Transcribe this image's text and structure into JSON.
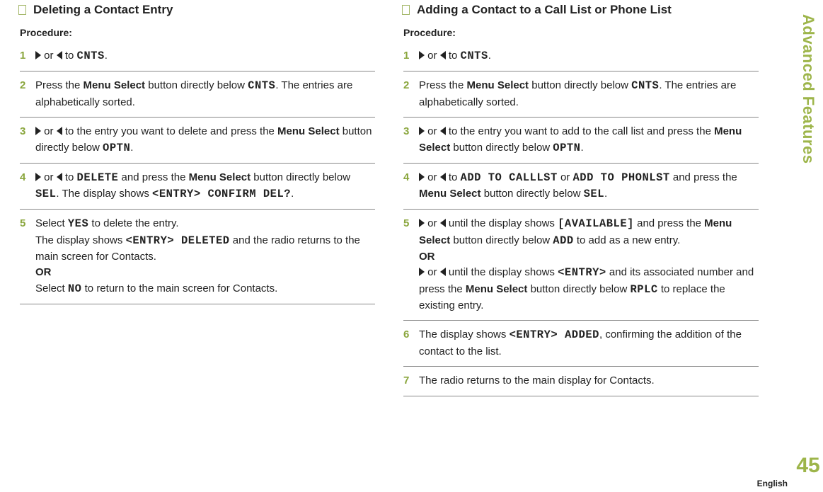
{
  "sidebar": {
    "label": "Advanced Features",
    "page": "45"
  },
  "footer": {
    "lang": "English"
  },
  "left": {
    "title": "Deleting a Contact Entry",
    "procedure": "Procedure:",
    "s1a": " or ",
    "s1b": " to ",
    "s1c": "CNTS",
    "s1d": ".",
    "s2a": "Press the ",
    "s2b": "Menu Select",
    "s2c": " button directly below ",
    "s2d": "CNTS",
    "s2e": ". The entries are alphabetically sorted.",
    "s3a": " or ",
    "s3b": " to the entry you want to delete and press the ",
    "s3c": "Menu Select",
    "s3d": " button directly below ",
    "s3e": "OPTN",
    "s3f": ".",
    "s4a": " or ",
    "s4b": " to ",
    "s4c": "DELETE",
    "s4d": " and press the ",
    "s4e": "Menu Select",
    "s4f": " button directly below ",
    "s4g": "SEL",
    "s4h": ". The display shows ",
    "s4i": "<ENTRY> CONFIRM DEL?",
    "s4j": ".",
    "s5a": "Select ",
    "s5b": "YES",
    "s5c": " to delete the entry.",
    "s5d": "The display shows ",
    "s5e": "<ENTRY> DELETED",
    "s5f": " and the radio returns to the main screen for Contacts.",
    "s5g": "OR",
    "s5h": "Select ",
    "s5i": "NO",
    "s5j": " to return to the main screen for Contacts."
  },
  "right": {
    "title": "Adding a Contact to a Call List or Phone List",
    "procedure": "Procedure:",
    "s1a": " or ",
    "s1b": " to ",
    "s1c": "CNTS",
    "s1d": ".",
    "s2a": "Press the ",
    "s2b": "Menu Select",
    "s2c": " button directly below ",
    "s2d": "CNTS",
    "s2e": ". The entries are alphabetically sorted.",
    "s3a": " or ",
    "s3b": " to the entry you want to add to the call list and press the ",
    "s3c": "Menu Select",
    "s3d": " button directly below ",
    "s3e": "OPTN",
    "s3f": ".",
    "s4a": " or ",
    "s4b": " to ",
    "s4c": "ADD TO CALLLST",
    "s4d": " or ",
    "s4e": "ADD TO PHONLST",
    "s4f": " and press the ",
    "s4g": "Menu Select",
    "s4h": " button directly below ",
    "s4i": "SEL",
    "s4j": ".",
    "s5a": " or ",
    "s5b": " until the display shows ",
    "s5c": "[AVAILABLE]",
    "s5d": " and press the ",
    "s5e": "Menu Select",
    "s5f": " button directly below ",
    "s5g": "ADD",
    "s5h": " to add as a new entry.",
    "s5i": "OR",
    "s5j": " or ",
    "s5k": " until the display shows ",
    "s5l": "<ENTRY>",
    "s5m": " and its associated number and press the ",
    "s5n": "Menu Select",
    "s5o": " button directly below ",
    "s5p": "RPLC",
    "s5q": " to replace the existing entry.",
    "s6a": "The display shows ",
    "s6b": "<ENTRY> ADDED",
    "s6c": ", confirming the addition of the contact to the list.",
    "s7a": "The radio returns to the main display for Contacts."
  }
}
